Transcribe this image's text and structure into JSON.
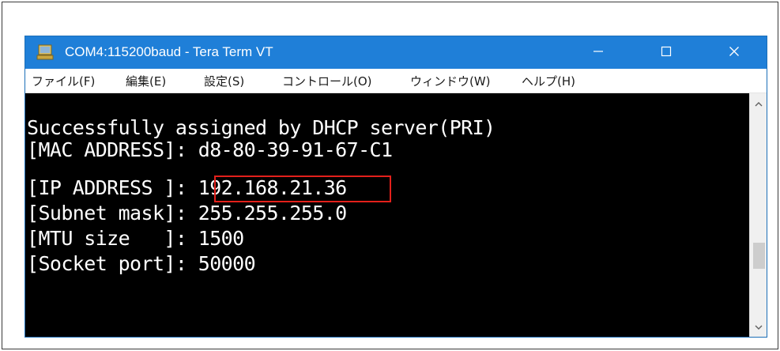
{
  "window": {
    "title": "COM4:115200baud - Tera Term VT",
    "titlebar_color": "#1f7fd8",
    "icons": {
      "app": "tera-term-icon",
      "minimize": "minimize-icon",
      "maximize": "maximize-icon",
      "close": "close-icon"
    }
  },
  "menu": {
    "items": [
      {
        "label": "ファイル(F)"
      },
      {
        "label": "編集(E)"
      },
      {
        "label": "設定(S)"
      },
      {
        "label": "コントロール(O)"
      },
      {
        "label": "ウィンドウ(W)"
      },
      {
        "label": "ヘルプ(H)"
      }
    ]
  },
  "terminal": {
    "background": "#000000",
    "foreground": "#ffffff",
    "lines": [
      "Successfully assigned by DHCP server(PRI)",
      "[MAC ADDRESS]: d8-80-39-91-67-C1",
      "[IP ADDRESS ]: 192.168.21.36",
      "[Subnet mask]: 255.255.255.0",
      "[MTU size   ]: 1500",
      "[Socket port]: 50000"
    ],
    "highlight_color": "#e3201b"
  },
  "scrollbar": {
    "icons": {
      "up": "scroll-up-arrow-icon",
      "down": "scroll-down-arrow-icon"
    }
  }
}
